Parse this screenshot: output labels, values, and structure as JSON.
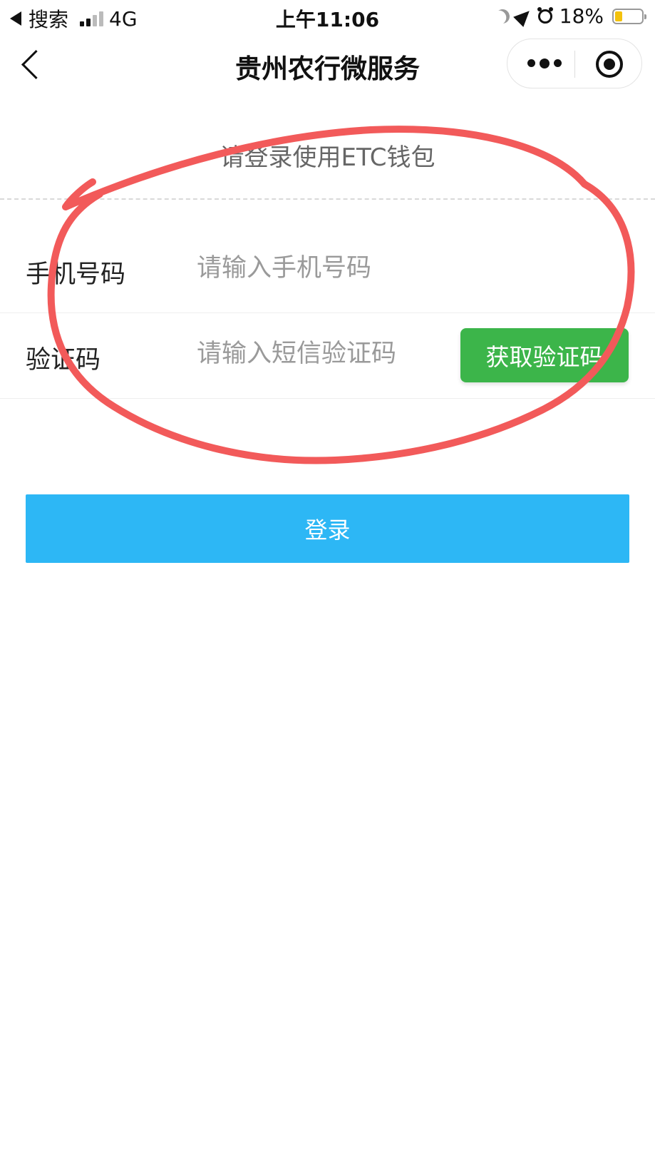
{
  "status_bar": {
    "back_app": "搜索",
    "network": "4G",
    "time": "上午11:06",
    "battery": "18%",
    "battery_level": 0.18,
    "battery_color": "#f4c20d",
    "icons": [
      "back-triangle-icon",
      "signal-icon",
      "moon-icon",
      "location-icon",
      "alarm-icon",
      "battery-icon"
    ]
  },
  "nav": {
    "title": "贵州农行微服务",
    "icons": [
      "back-chevron-icon",
      "more-dots-icon",
      "close-target-icon"
    ]
  },
  "login": {
    "hint": "请登录使用ETC钱包",
    "phone_label": "手机号码",
    "phone_placeholder": "请输入手机号码",
    "phone_value": "",
    "code_label": "验证码",
    "code_placeholder": "请输入短信验证码",
    "code_value": "",
    "get_code_label": "获取验证码",
    "login_label": "登录"
  },
  "colors": {
    "get_code_button": "#3cb54a",
    "login_button": "#2db7f5",
    "annotation": "#f25a5a"
  }
}
